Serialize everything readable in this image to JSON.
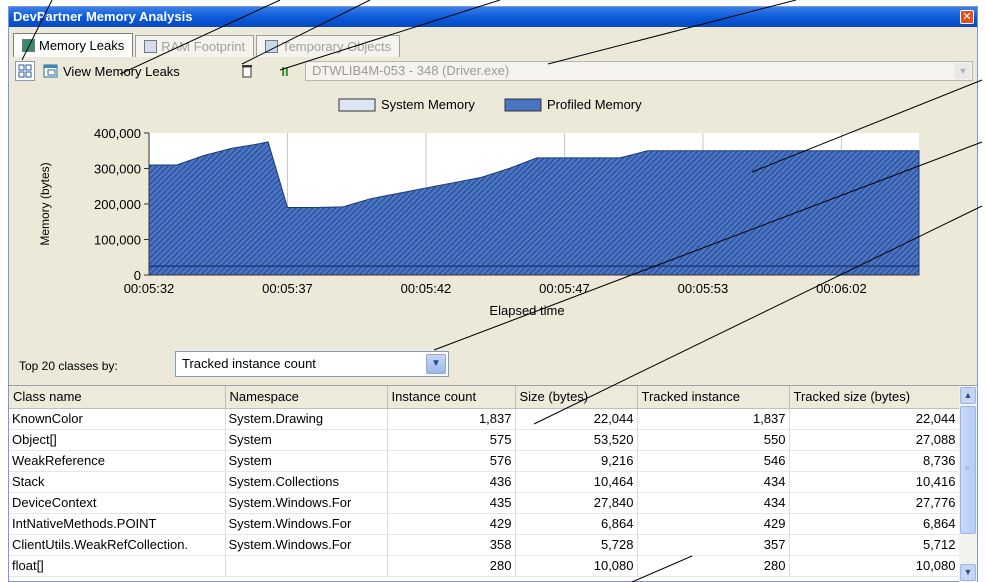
{
  "window": {
    "title": "DevPartner Memory Analysis",
    "close_label": "✕"
  },
  "tabs": [
    {
      "label": "Memory Leaks",
      "active": true
    },
    {
      "label": "RAM Footprint",
      "active": false
    },
    {
      "label": "Temporary Objects",
      "active": false
    }
  ],
  "toolbar": {
    "view_leaks_label": "View Memory Leaks",
    "pause_symbol": "II",
    "process": "DTWLIB4M-053 - 348 (Driver.exe)"
  },
  "chart_data": {
    "type": "area",
    "legend": [
      "System Memory",
      "Profiled Memory"
    ],
    "legend_position": "top",
    "xlabel": "Elapsed time",
    "ylabel": "Memory (bytes)",
    "ylim": [
      0,
      400000
    ],
    "y_ticks": [
      "0",
      "100,000",
      "200,000",
      "300,000",
      "400,000"
    ],
    "y_tick_values": [
      0,
      100000,
      200000,
      300000,
      400000
    ],
    "x_tick_labels": [
      "00:05:32",
      "00:05:37",
      "00:05:42",
      "00:05:47",
      "00:05:53",
      "00:06:02"
    ],
    "x_tick_positions": [
      0,
      5,
      10,
      15,
      20,
      25
    ],
    "xlim": [
      0,
      27.8
    ],
    "series": [
      {
        "name": "System Memory",
        "values": [
          25000,
          25000,
          25000,
          25000,
          25000,
          25000
        ]
      },
      {
        "name": "Profiled Memory",
        "x": [
          0,
          1,
          2,
          3,
          4,
          4.3,
          5,
          6,
          7,
          8,
          9,
          10,
          11,
          12,
          13,
          14,
          15,
          16,
          17,
          18,
          19,
          20,
          21,
          22,
          23,
          24,
          25,
          26,
          27.8
        ],
        "values": [
          310000,
          310000,
          337000,
          357000,
          370000,
          375000,
          190000,
          190000,
          192000,
          215000,
          230000,
          245000,
          260000,
          275000,
          300000,
          330000,
          330000,
          330000,
          330000,
          350000,
          350000,
          350000,
          350000,
          350000,
          350000,
          350000,
          350000,
          350000,
          350000
        ]
      }
    ],
    "grid": true
  },
  "filter": {
    "label": "Top 20 classes by:",
    "value": "Tracked instance count"
  },
  "table": {
    "columns": [
      "Class name",
      "Namespace",
      "Instance count",
      "Size (bytes)",
      "Tracked instance",
      "Tracked size (bytes)"
    ],
    "rows": [
      [
        "KnownColor",
        "System.Drawing",
        "1,837",
        "22,044",
        "1,837",
        "22,044"
      ],
      [
        "Object[]",
        "System",
        "575",
        "53,520",
        "550",
        "27,088"
      ],
      [
        "WeakReference",
        "System",
        "576",
        "9,216",
        "546",
        "8,736"
      ],
      [
        "Stack",
        "System.Collections",
        "436",
        "10,464",
        "434",
        "10,416"
      ],
      [
        "DeviceContext",
        "System.Windows.For",
        "435",
        "27,840",
        "434",
        "27,776"
      ],
      [
        "IntNativeMethods.POINT",
        "System.Windows.For",
        "429",
        "6,864",
        "429",
        "6,864"
      ],
      [
        "ClientUtils.WeakRefCollection.",
        "System.Windows.For",
        "358",
        "5,728",
        "357",
        "5,712"
      ],
      [
        "float[]",
        "",
        "280",
        "10,080",
        "280",
        "10,080"
      ]
    ]
  },
  "colors": {
    "profiled": "#4a74c4",
    "system": "#dde4f4",
    "titlebar": "#0a58d8",
    "chrome": "#ece9d8"
  }
}
